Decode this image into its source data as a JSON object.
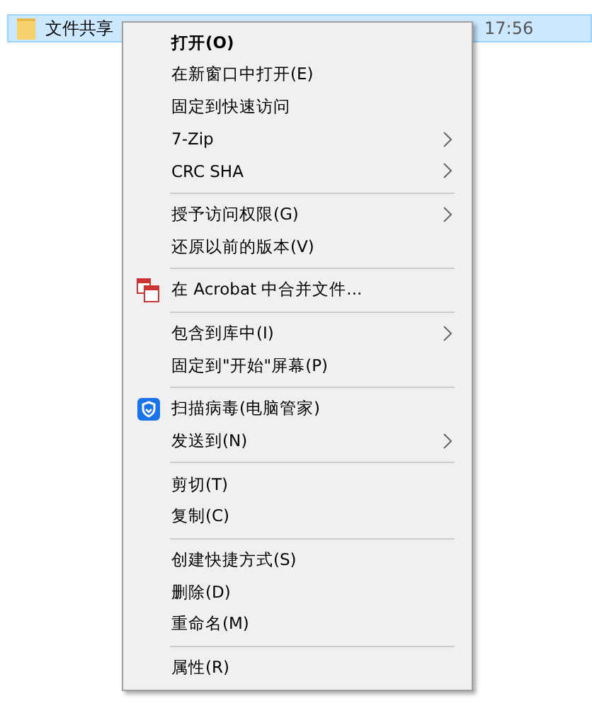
{
  "file_row": {
    "name": "文件共享",
    "time": "17:56",
    "selected": true
  },
  "menu": {
    "sections": [
      {
        "items": [
          {
            "label": "打开(O)",
            "default": true,
            "submenu": false
          },
          {
            "label": "在新窗口中打开(E)",
            "default": false,
            "submenu": false
          },
          {
            "label": "固定到快速访问",
            "default": false,
            "submenu": false
          },
          {
            "label": "7-Zip",
            "default": false,
            "submenu": true
          },
          {
            "label": "CRC SHA",
            "default": false,
            "submenu": true
          }
        ]
      },
      {
        "items": [
          {
            "label": "授予访问权限(G)",
            "default": false,
            "submenu": true
          },
          {
            "label": "还原以前的版本(V)",
            "default": false,
            "submenu": false
          }
        ]
      },
      {
        "items": [
          {
            "label": "在 Acrobat 中合并文件...",
            "default": false,
            "submenu": false,
            "kind": "acrobat"
          }
        ]
      },
      {
        "items": [
          {
            "label": "包含到库中(I)",
            "default": false,
            "submenu": true
          },
          {
            "label": "固定到\"开始\"屏幕(P)",
            "default": false,
            "submenu": false
          }
        ]
      },
      {
        "items": [
          {
            "label": "扫描病毒(电脑管家)",
            "default": false,
            "submenu": false,
            "kind": "shield"
          },
          {
            "label": "发送到(N)",
            "default": false,
            "submenu": true
          }
        ]
      },
      {
        "items": [
          {
            "label": "剪切(T)",
            "default": false,
            "submenu": false
          },
          {
            "label": "复制(C)",
            "default": false,
            "submenu": false
          }
        ]
      },
      {
        "items": [
          {
            "label": "创建快捷方式(S)",
            "default": false,
            "submenu": false
          },
          {
            "label": "删除(D)",
            "default": false,
            "submenu": false
          },
          {
            "label": "重命名(M)",
            "default": false,
            "submenu": false
          }
        ]
      },
      {
        "items": [
          {
            "label": "属性(R)",
            "default": false,
            "submenu": false
          }
        ]
      }
    ]
  }
}
